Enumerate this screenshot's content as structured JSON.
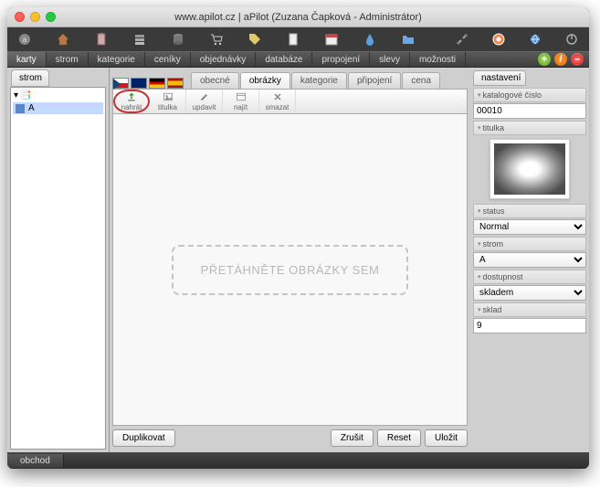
{
  "window": {
    "title": "www.apilot.cz | aPilot (Zuzana Čapková - Administrátor)"
  },
  "menubar": {
    "items": [
      "karty",
      "strom",
      "kategorie",
      "ceníky",
      "objednávky",
      "databáze",
      "propojení",
      "slevy",
      "možnosti"
    ],
    "active_index": 0
  },
  "left": {
    "tab_label": "strom",
    "root_label": "",
    "item_label": "A"
  },
  "mid": {
    "tabs": [
      "obecné",
      "obrázky",
      "kategorie",
      "připojení",
      "cena"
    ],
    "active_tab_index": 1,
    "toolbar": [
      {
        "label": "nahrát",
        "icon": "upload"
      },
      {
        "label": "titulka",
        "icon": "image"
      },
      {
        "label": "updavit",
        "icon": "edit"
      },
      {
        "label": "najít",
        "icon": "search"
      },
      {
        "label": "smazat",
        "icon": "delete"
      }
    ],
    "highlight_index": 0,
    "dropzone_text": "PŘETÁHNĚTE OBRÁZKY SEM",
    "buttons": {
      "duplicate": "Duplikovat",
      "cancel": "Zrušit",
      "reset": "Reset",
      "save": "Uložit"
    }
  },
  "right": {
    "panel_label": "nastavení",
    "fields": {
      "katalog_label": "katalogové číslo",
      "katalog_value": "00010",
      "titulka_label": "titulka",
      "status_label": "status",
      "status_value": "Normal",
      "strom_label": "strom",
      "strom_value": "A",
      "dostupnost_label": "dostupnost",
      "dostupnost_value": "skladem",
      "sklad_label": "sklad",
      "sklad_value": "9"
    }
  },
  "statusbar": {
    "tab": "obchod"
  }
}
